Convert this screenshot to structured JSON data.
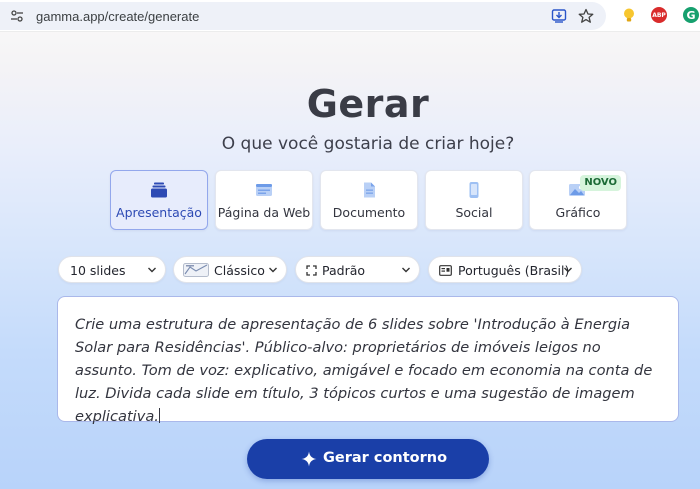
{
  "browser": {
    "url": "gamma.app/create/generate",
    "icons": [
      "tune-icon",
      "install-app-icon",
      "bookmark-star-icon",
      "lightbulb-extension-icon",
      "adblock-extension-icon",
      "grammarly-extension-icon"
    ],
    "abp_label": "ABP",
    "grammarly_label": "G"
  },
  "header": {
    "title": "Gerar",
    "subtitle": "O que você gostaria de criar hoje?"
  },
  "content_types": [
    {
      "label": "Apresentação",
      "icon": "presentation-stack-icon",
      "selected": true
    },
    {
      "label": "Página da Web",
      "icon": "webpage-icon",
      "selected": false
    },
    {
      "label": "Documento",
      "icon": "document-icon",
      "selected": false
    },
    {
      "label": "Social",
      "icon": "phone-icon",
      "selected": false
    },
    {
      "label": "Gráfico",
      "icon": "image-chart-icon",
      "selected": false,
      "badge": "NOVO"
    }
  ],
  "options": {
    "slides_count": "10 slides",
    "theme": "Clássico",
    "format": "Padrão",
    "language": "Português (Brasil)"
  },
  "prompt": {
    "text": "Crie uma estrutura de apresentação de 6 slides sobre 'Introdução à Energia Solar para Residências'. Público-alvo: proprietários de imóveis leigos no assunto. Tom de voz: explicativo, amigável e focado em economia na conta de luz. Divida cada slide em título, 3 tópicos curtos e uma sugestão de imagem explicativa."
  },
  "actions": {
    "generate_label": "Gerar contorno"
  },
  "colors": {
    "primary": "#1a3fa8",
    "selected_card_bg": "#e7ecfc",
    "selected_card_border": "#93a7ec",
    "badge_bg": "#d6f4dc",
    "badge_text": "#1c6a36"
  }
}
